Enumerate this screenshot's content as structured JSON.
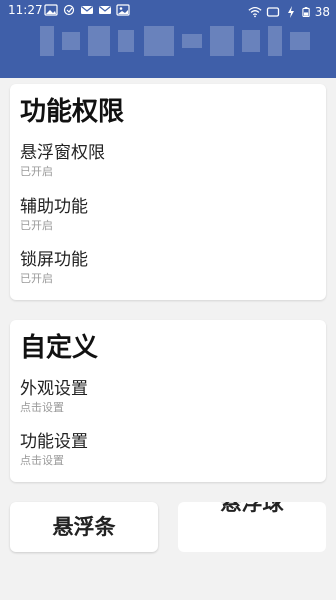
{
  "status_bar": {
    "time": "11:27",
    "battery": "38"
  },
  "permissions": {
    "title": "功能权限",
    "items": [
      {
        "label": "悬浮窗权限",
        "sub": "已开启"
      },
      {
        "label": "辅助功能",
        "sub": "已开启"
      },
      {
        "label": "锁屏功能",
        "sub": "已开启"
      }
    ]
  },
  "custom": {
    "title": "自定义",
    "items": [
      {
        "label": "外观设置",
        "sub": "点击设置"
      },
      {
        "label": "功能设置",
        "sub": "点击设置"
      }
    ]
  },
  "buttons": {
    "left": "悬浮条",
    "right": "悬浮球"
  }
}
